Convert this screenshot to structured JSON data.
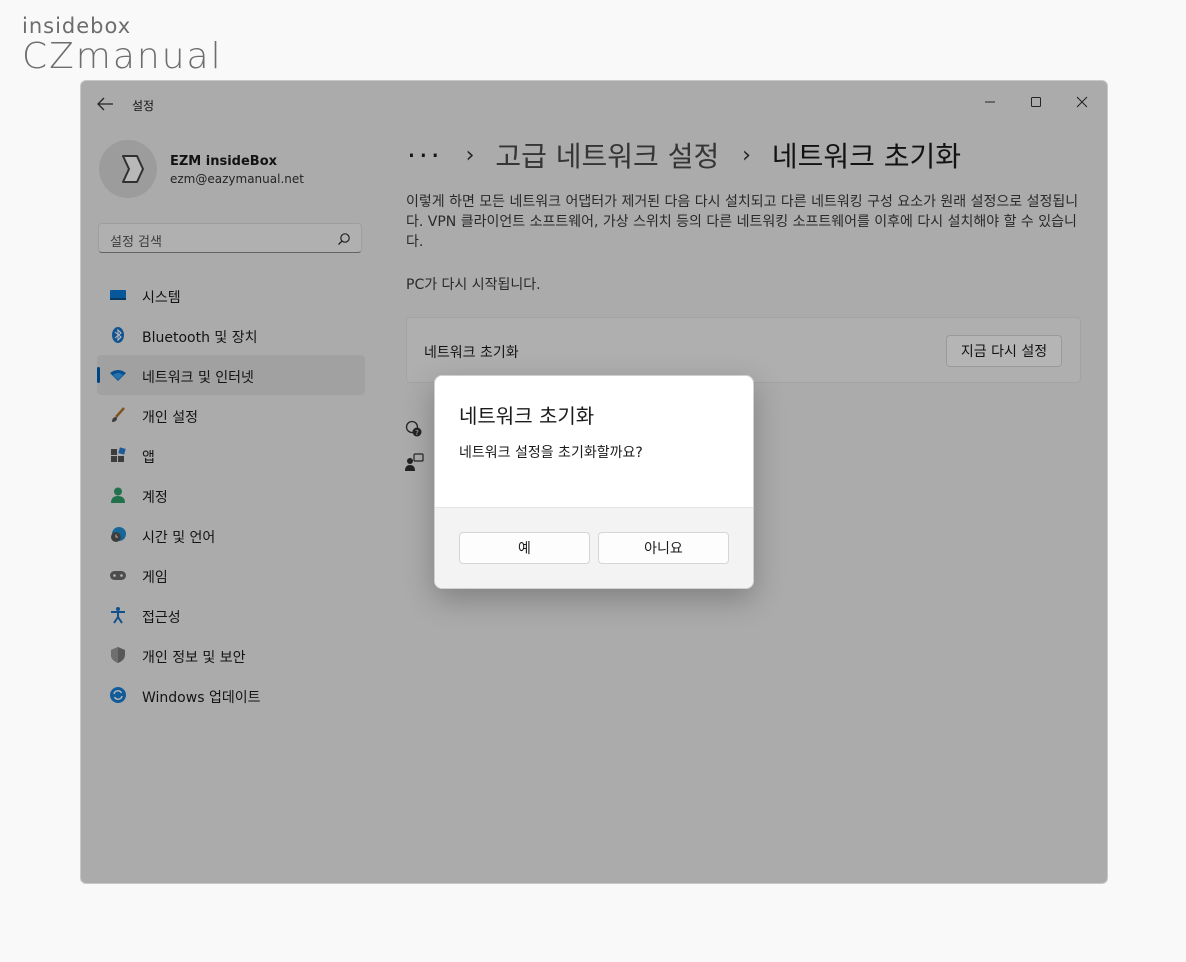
{
  "logo": {
    "line1": "insidebox",
    "line2": "CZmanual"
  },
  "window": {
    "title": "설정",
    "controls": {
      "minimize_icon": "minimize-icon",
      "maximize_icon": "maximize-icon",
      "close_icon": "close-icon"
    }
  },
  "user": {
    "name": "EZM insideBox",
    "email": "ezm@eazymanual.net"
  },
  "search": {
    "placeholder": "설정 검색"
  },
  "sidebar": {
    "items": [
      {
        "label": "시스템",
        "icon": "system-icon"
      },
      {
        "label": "Bluetooth 및 장치",
        "icon": "bluetooth-icon"
      },
      {
        "label": "네트워크 및 인터넷",
        "icon": "network-icon",
        "active": true
      },
      {
        "label": "개인 설정",
        "icon": "brush-icon"
      },
      {
        "label": "앱",
        "icon": "apps-icon"
      },
      {
        "label": "계정",
        "icon": "account-icon"
      },
      {
        "label": "시간 및 언어",
        "icon": "time-language-icon"
      },
      {
        "label": "게임",
        "icon": "gaming-icon"
      },
      {
        "label": "접근성",
        "icon": "accessibility-icon"
      },
      {
        "label": "개인 정보 및 보안",
        "icon": "shield-icon"
      },
      {
        "label": "Windows 업데이트",
        "icon": "update-icon"
      }
    ]
  },
  "breadcrumb": {
    "more": "···",
    "parent": "고급 네트워크 설정",
    "current": "네트워크 초기화"
  },
  "content": {
    "description": "이렇게 하면 모든 네트워크 어댑터가 제거된 다음 다시 설치되고 다른 네트워킹 구성 요소가 원래 설정으로 설정됩니다. VPN 클라이언트 소프트웨어, 가상 스위치 등의 다른 네트워킹 소프트웨어를 이후에 다시 설치해야 할 수 있습니다.",
    "restart_note": "PC가 다시 시작됩니다.",
    "card_label": "네트워크 초기화",
    "reset_button": "지금 다시 설정"
  },
  "dialog": {
    "title": "네트워크 초기화",
    "message": "네트워크 설정을 초기화할까요?",
    "yes": "예",
    "no": "아니요"
  },
  "colors": {
    "accent": "#005fb8",
    "overlay": "rgba(0,0,0,0.28)"
  }
}
